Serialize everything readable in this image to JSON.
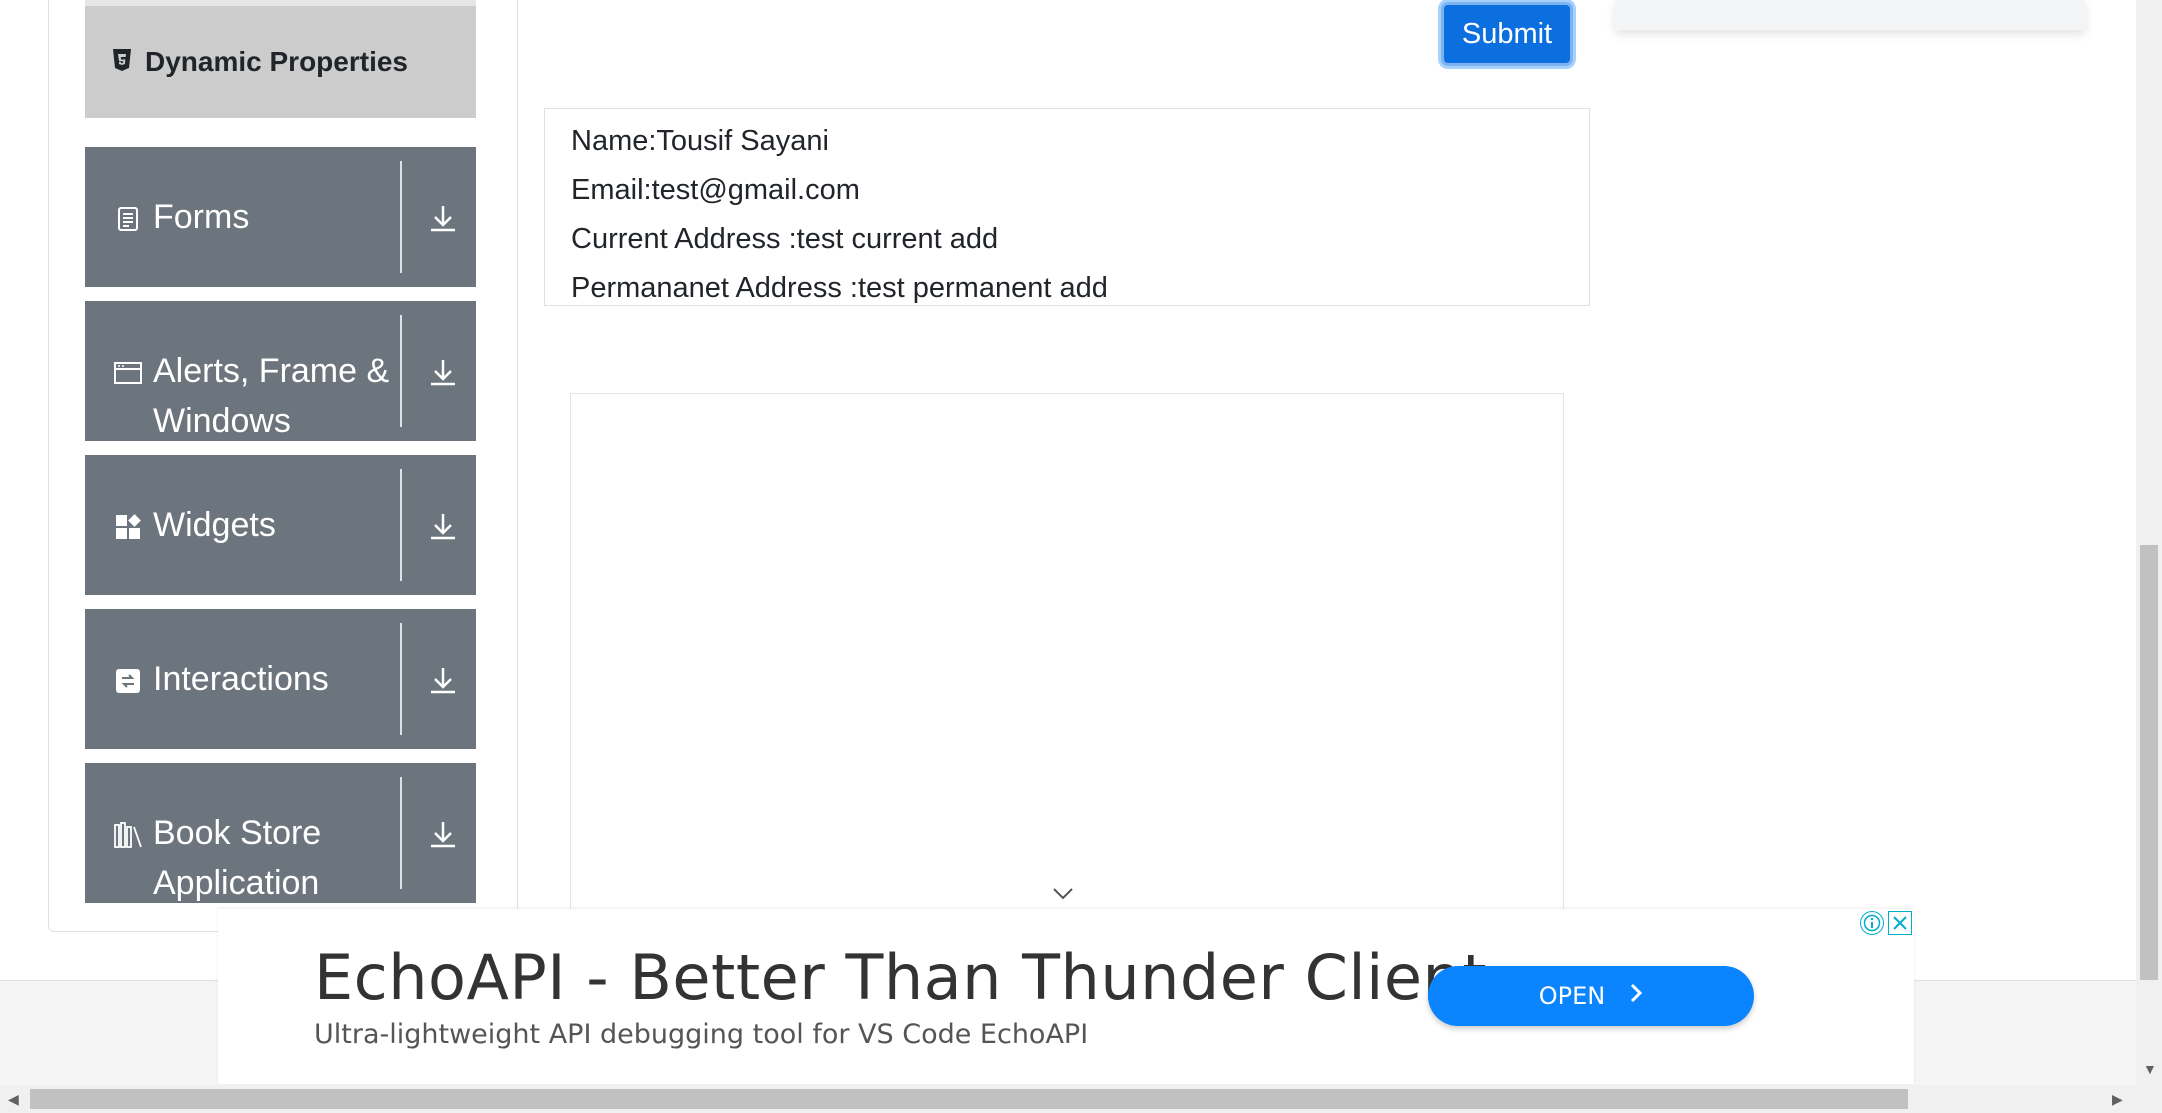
{
  "sidebar": {
    "active_item": {
      "label": "Dynamic Properties",
      "icon": "html5-icon"
    },
    "groups": [
      {
        "label": "Forms",
        "icon": "document-icon"
      },
      {
        "label": "Alerts, Frame & Windows",
        "icon": "window-icon"
      },
      {
        "label": "Widgets",
        "icon": "widgets-icon"
      },
      {
        "label": "Interactions",
        "icon": "interactions-icon"
      },
      {
        "label": "Book Store Application",
        "icon": "books-icon"
      }
    ]
  },
  "form": {
    "submit_label": "Submit"
  },
  "output": {
    "name": "Name:Tousif Sayani",
    "email": "Email:test@gmail.com",
    "current_address": "Current Address :test current add",
    "permanent_address": "Permananet Address :test permanent add"
  },
  "ad": {
    "title": "EchoAPI - Better Than Thunder Client",
    "subtitle": "Ultra-lightweight API debugging tool for VS Code EchoAPI",
    "cta_label": "OPEN"
  },
  "colors": {
    "group_bg": "#6c757d",
    "active_bg": "#cccccc",
    "submit_bg": "#0b6fdf",
    "ad_cta_bg": "#0a84ff"
  }
}
